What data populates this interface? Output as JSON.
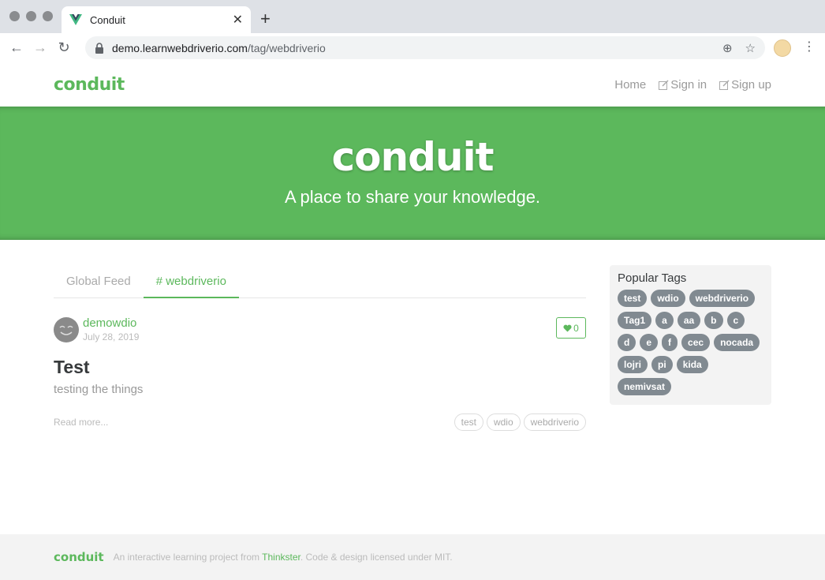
{
  "browser": {
    "tab_title": "Conduit",
    "url_host": "demo.learnwebdriverio.com",
    "url_path": "/tag/webdriverio",
    "newtab_label": "+",
    "close_label": "✕",
    "back_label": "←",
    "forward_label": "→",
    "reload_label": "↻",
    "add_label": "⊕",
    "star_label": "☆",
    "menu_label": "⋮"
  },
  "navbar": {
    "brand": "conduit",
    "links": [
      {
        "label": "Home"
      },
      {
        "label": "Sign in"
      },
      {
        "label": "Sign up"
      }
    ]
  },
  "banner": {
    "title": "conduit",
    "subtitle": "A place to share your knowledge."
  },
  "feed": {
    "tabs": [
      {
        "label": "Global Feed"
      },
      {
        "label": "# webdriverio"
      }
    ],
    "articles": [
      {
        "author": "demowdio",
        "date": "July 28, 2019",
        "likes": "0",
        "title": "Test",
        "description": "testing the things",
        "read_more": "Read more...",
        "tags": [
          "test",
          "wdio",
          "webdriverio"
        ]
      }
    ]
  },
  "sidebar": {
    "heading": "Popular Tags",
    "tags": [
      "test",
      "wdio",
      "webdriverio",
      "Tag1",
      "a",
      "aa",
      "b",
      "c",
      "d",
      "e",
      "f",
      "cec",
      "nocada",
      "lojri",
      "pi",
      "kida",
      "nemivsat"
    ]
  },
  "footer": {
    "logo": "conduit",
    "text_before": "An interactive learning project from ",
    "link": "Thinkster",
    "text_after": ". Code & design licensed under MIT."
  },
  "colors": {
    "brand_green": "#5cb85c",
    "tag_gray": "#818a91"
  }
}
